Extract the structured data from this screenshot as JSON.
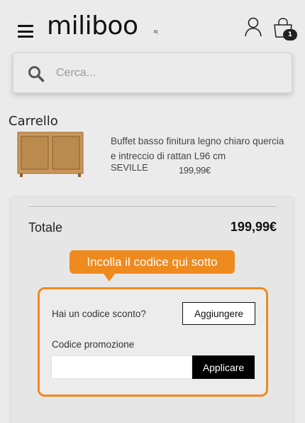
{
  "header": {
    "logo_text": "miliboo",
    "logo_tld": ".it",
    "cart_count": "1",
    "icons": [
      "hamburger-menu-icon",
      "user-icon",
      "cart-bag-icon"
    ]
  },
  "search": {
    "placeholder": "Cerca...",
    "value": ""
  },
  "cart": {
    "title": "Carrello",
    "items": [
      {
        "name": "Buffet basso finitura legno chiaro quercia e intreccio di rattan L96 cm",
        "collection": "SEVILLE",
        "price": "199,99€"
      }
    ]
  },
  "summary": {
    "total_label": "Totale",
    "total_value": "199,99€"
  },
  "promo": {
    "tooltip": "Incolla il codice qui sotto",
    "discount_question": "Hai un codice sconto?",
    "add_button": "Aggiungere",
    "code_label": "Codice promozione",
    "code_value": "",
    "apply_button": "Applicare"
  },
  "colors": {
    "accent": "#ef8a1f",
    "background": "#ebebeb",
    "primary_button": "#000000"
  }
}
